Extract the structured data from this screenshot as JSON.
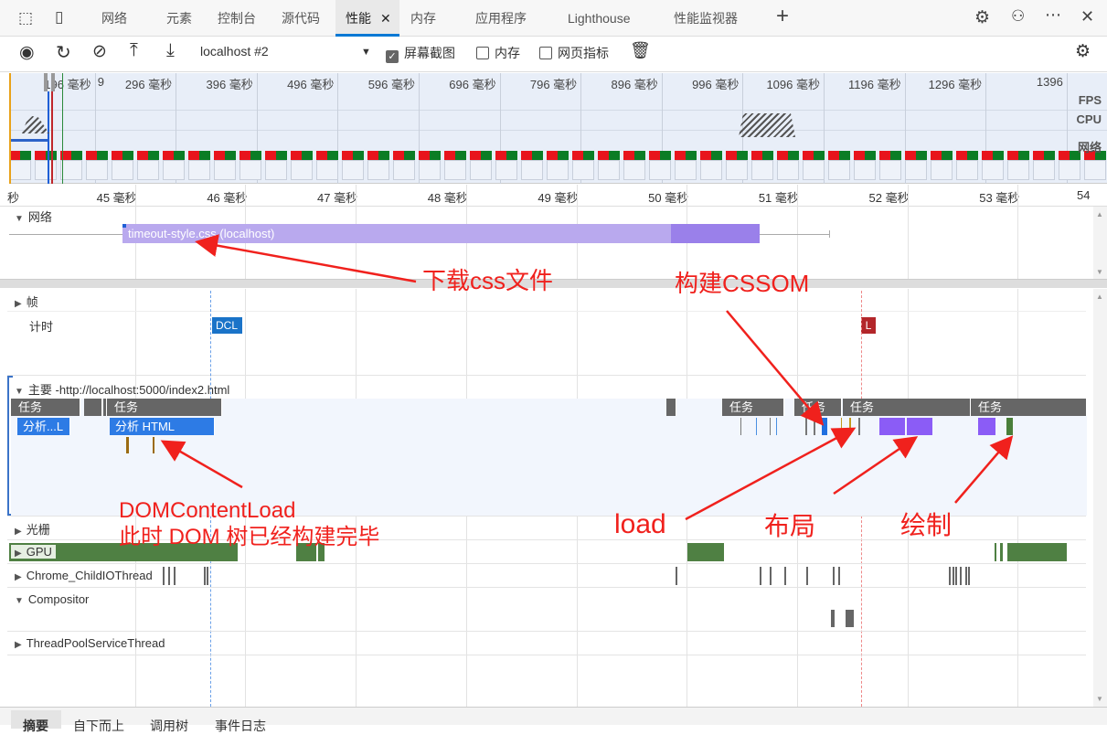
{
  "tabs": [
    "网络",
    "元素",
    "控制台",
    "源代码",
    "性能",
    "内存",
    "应用程序",
    "Lighthouse",
    "性能监视器"
  ],
  "active_tab": "性能",
  "toolbar": {
    "target": "localhost #2",
    "screenshots": "屏幕截图",
    "memory": "内存",
    "web_vitals": "网页指标",
    "screenshots_checked": true
  },
  "overview": {
    "ticks": [
      "9",
      "196 毫秒",
      "296 毫秒",
      "396 毫秒",
      "496 毫秒",
      "596 毫秒",
      "696 毫秒",
      "796 毫秒",
      "896 毫秒",
      "996 毫秒",
      "1096 毫秒",
      "1196 毫秒",
      "1296 毫秒",
      "1396"
    ],
    "labels": {
      "fps": "FPS",
      "cpu": "CPU",
      "net": "网络"
    }
  },
  "ruler": [
    "秒",
    "45 毫秒",
    "46 毫秒",
    "47 毫秒",
    "48 毫秒",
    "49 毫秒",
    "50 毫秒",
    "51 毫秒",
    "52 毫秒",
    "53 毫秒",
    "54"
  ],
  "network": {
    "label": "网络",
    "request": "timeout-style.css (localhost)"
  },
  "tracks": {
    "frames": "帧",
    "timings": "计时",
    "dcl": "DCL",
    "load": "L",
    "main": "主要 -http://localhost:5000/index2.html",
    "raster": "光栅",
    "gpu": "GPU",
    "io": "Chrome_ChildIOThread",
    "compositor": "Compositor",
    "threadpool": "ThreadPoolServiceThread"
  },
  "main_tasks": {
    "task": "任务",
    "parse1": "分析...L",
    "parse2": "分析 HTML"
  },
  "annotations": {
    "css": "下载css文件",
    "cssom": "构建CSSOM",
    "dcl1": "DOMContentLoad",
    "dcl2": "此时 DOM 树已经构建完毕",
    "load": "load",
    "layout": "布局",
    "paint": "绘制"
  },
  "bottom_tabs": [
    "摘要",
    "自下而上",
    "调用树",
    "事件日志"
  ],
  "colors": {
    "accent": "#0078d4",
    "annotation": "#f0211d",
    "task": "#666666",
    "parse": "#2d7be5",
    "layout": "#8b5cf6",
    "paint": "#4a7f3a",
    "css": "#b9a9ee"
  }
}
